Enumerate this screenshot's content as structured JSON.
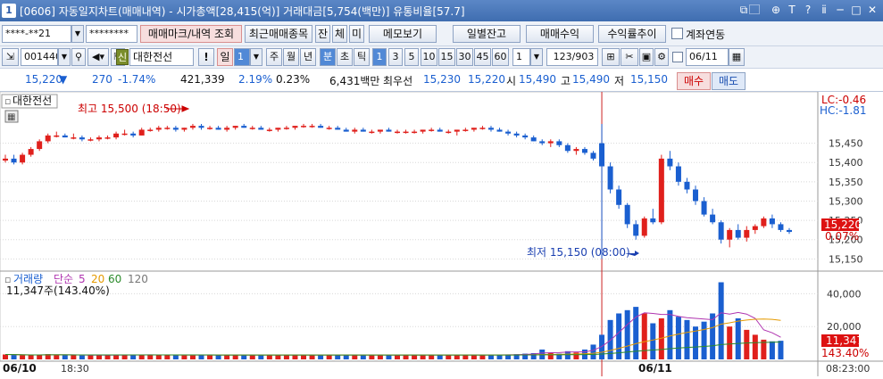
{
  "titlebar": {
    "number": "1",
    "text": "[0606] 자동일지차트(매매내역) - 시가총액[28,415(억)] 거래대금[5,754(백만)] 유통비율[57.7]",
    "buttons": [
      "⧉",
      "⃞",
      "⊕",
      "T",
      "?",
      "ⅱ",
      "─",
      "□",
      "✕"
    ]
  },
  "toolbar1": {
    "account": "****-**21",
    "password": "********",
    "trade_mark": "매매마크/내역 조회",
    "recent": "최근매매종목",
    "jan": "잔",
    "che": "체",
    "mi": "미",
    "memo": "메모보기",
    "daily_balance": "일별잔고",
    "trade_profit": "매매수익",
    "profit_trend": "수익률추이",
    "account_link": "계좌연동"
  },
  "toolbar2": {
    "code": "001440",
    "stock_tag": "신",
    "stock_name": "대한전선",
    "alert": "!",
    "day": "일",
    "day_value": "1",
    "periods": [
      "주",
      "월",
      "년"
    ],
    "min_label": "분",
    "tick1": "초",
    "tick2": "틱",
    "intervals": [
      "1",
      "3",
      "5",
      "10",
      "15",
      "30",
      "45",
      "60"
    ],
    "interval_input": "1",
    "count": "123",
    "count_total": "/903",
    "date": "06/11"
  },
  "quote": {
    "price": "15,220",
    "arrow": "▼",
    "change": "270",
    "change_pct": "-1.74%",
    "volume": "421,339",
    "vol_pct": "2.19%",
    "turnover_pct": "0.23%",
    "amount": "6,431백만",
    "best_label": "최우선",
    "best_ask": "15,230",
    "best_bid": "15,220",
    "open_label": "시",
    "open": "15,490",
    "high_label": "고",
    "high": "15,490",
    "low_label": "저",
    "low": "15,150",
    "buy": "매수",
    "sell": "매도"
  },
  "chart_labels": {
    "stock_label": "대한전선",
    "lc": "LC:-0.46",
    "hc": "HC:-1.81",
    "high_note": "최고 15,500 (18:50)",
    "low_note": "최저 15,150 (08:00)",
    "vol_title": "거래량",
    "ma_label": "단순",
    "ma5": "5",
    "ma20": "20",
    "ma60": "60",
    "ma120": "120",
    "vol_value": "11,347주(143.40%)",
    "x_left": "06/10",
    "x_mid": "18:30",
    "x_day2": "06/11",
    "time_right": "08:23:00",
    "price_now": "15,220",
    "price_pct": "0.07%",
    "vol_now": "11,347",
    "vol_pct": "143.40%"
  },
  "chart_data": {
    "type": "candlestick",
    "price_axis_ticks": [
      15150,
      15200,
      15250,
      15300,
      15350,
      15400,
      15450
    ],
    "volume_axis_ticks": [
      20000,
      40000
    ],
    "day2_x_index": 70,
    "prices": [
      [
        15405,
        15420,
        15400,
        15410
      ],
      [
        15410,
        15420,
        15395,
        15400
      ],
      [
        15400,
        15425,
        15395,
        15420
      ],
      [
        15420,
        15440,
        15415,
        15435
      ],
      [
        15435,
        15460,
        15430,
        15455
      ],
      [
        15455,
        15475,
        15450,
        15470
      ],
      [
        15470,
        15480,
        15465,
        15470
      ],
      [
        15470,
        15475,
        15465,
        15465
      ],
      [
        15465,
        15475,
        15460,
        15465
      ],
      [
        15465,
        15470,
        15455,
        15460
      ],
      [
        15460,
        15465,
        15455,
        15460
      ],
      [
        15460,
        15470,
        15455,
        15465
      ],
      [
        15465,
        15470,
        15460,
        15465
      ],
      [
        15465,
        15480,
        15460,
        15475
      ],
      [
        15475,
        15485,
        15470,
        15475
      ],
      [
        15475,
        15480,
        15465,
        15470
      ],
      [
        15470,
        15490,
        15470,
        15485
      ],
      [
        15485,
        15490,
        15480,
        15485
      ],
      [
        15485,
        15495,
        15480,
        15490
      ],
      [
        15490,
        15495,
        15485,
        15490
      ],
      [
        15490,
        15495,
        15480,
        15485
      ],
      [
        15485,
        15490,
        15480,
        15490
      ],
      [
        15490,
        15500,
        15485,
        15495
      ],
      [
        15495,
        15500,
        15485,
        15490
      ],
      [
        15490,
        15495,
        15485,
        15490
      ],
      [
        15490,
        15495,
        15485,
        15485
      ],
      [
        15485,
        15495,
        15480,
        15490
      ],
      [
        15490,
        15495,
        15485,
        15495
      ],
      [
        15495,
        15500,
        15490,
        15490
      ],
      [
        15490,
        15495,
        15485,
        15490
      ],
      [
        15490,
        15495,
        15485,
        15485
      ],
      [
        15485,
        15490,
        15480,
        15485
      ],
      [
        15485,
        15490,
        15480,
        15490
      ],
      [
        15490,
        15495,
        15485,
        15490
      ],
      [
        15490,
        15495,
        15485,
        15495
      ],
      [
        15495,
        15500,
        15490,
        15495
      ],
      [
        15495,
        15500,
        15490,
        15495
      ],
      [
        15495,
        15500,
        15490,
        15490
      ],
      [
        15490,
        15495,
        15485,
        15490
      ],
      [
        15490,
        15495,
        15485,
        15485
      ],
      [
        15485,
        15490,
        15480,
        15480
      ],
      [
        15480,
        15490,
        15475,
        15485
      ],
      [
        15485,
        15490,
        15480,
        15480
      ],
      [
        15480,
        15485,
        15475,
        15480
      ],
      [
        15480,
        15485,
        15475,
        15485
      ],
      [
        15485,
        15490,
        15480,
        15480
      ],
      [
        15480,
        15485,
        15475,
        15480
      ],
      [
        15480,
        15485,
        15475,
        15480
      ],
      [
        15480,
        15485,
        15475,
        15480
      ],
      [
        15480,
        15485,
        15475,
        15485
      ],
      [
        15485,
        15490,
        15480,
        15485
      ],
      [
        15485,
        15490,
        15480,
        15480
      ],
      [
        15480,
        15485,
        15475,
        15480
      ],
      [
        15480,
        15485,
        15470,
        15485
      ],
      [
        15485,
        15490,
        15480,
        15485
      ],
      [
        15485,
        15490,
        15480,
        15490
      ],
      [
        15490,
        15495,
        15485,
        15490
      ],
      [
        15490,
        15495,
        15480,
        15485
      ],
      [
        15485,
        15490,
        15480,
        15480
      ],
      [
        15480,
        15485,
        15470,
        15475
      ],
      [
        15475,
        15480,
        15465,
        15470
      ],
      [
        15470,
        15475,
        15460,
        15465
      ],
      [
        15465,
        15470,
        15455,
        15455
      ],
      [
        15455,
        15460,
        15445,
        15450
      ],
      [
        15450,
        15460,
        15440,
        15455
      ],
      [
        15455,
        15460,
        15440,
        15445
      ],
      [
        15445,
        15450,
        15425,
        15430
      ],
      [
        15430,
        15440,
        15420,
        15435
      ],
      [
        15435,
        15440,
        15420,
        15425
      ],
      [
        15425,
        15430,
        15405,
        15410
      ],
      [
        15450,
        15500,
        15150,
        15390
      ],
      [
        15390,
        15400,
        15320,
        15330
      ],
      [
        15330,
        15340,
        15280,
        15290
      ],
      [
        15290,
        15295,
        15230,
        15240
      ],
      [
        15240,
        15250,
        15200,
        15210
      ],
      [
        15210,
        15260,
        15205,
        15255
      ],
      [
        15255,
        15280,
        15240,
        15245
      ],
      [
        15245,
        15420,
        15240,
        15410
      ],
      [
        15410,
        15430,
        15380,
        15390
      ],
      [
        15390,
        15400,
        15340,
        15350
      ],
      [
        15350,
        15360,
        15320,
        15330
      ],
      [
        15330,
        15340,
        15290,
        15300
      ],
      [
        15300,
        15310,
        15260,
        15265
      ],
      [
        15265,
        15280,
        15240,
        15245
      ],
      [
        15245,
        15250,
        15190,
        15200
      ],
      [
        15200,
        15230,
        15180,
        15225
      ],
      [
        15225,
        15240,
        15200,
        15205
      ],
      [
        15205,
        15235,
        15195,
        15225
      ],
      [
        15225,
        15240,
        15215,
        15235
      ],
      [
        15235,
        15260,
        15230,
        15255
      ],
      [
        15255,
        15265,
        15230,
        15240
      ],
      [
        15240,
        15245,
        15220,
        15225
      ],
      [
        15225,
        15230,
        15215,
        15220
      ]
    ],
    "volumes": [
      3000,
      2800,
      2500,
      2600,
      2800,
      3200,
      2700,
      2500,
      2600,
      2400,
      2600,
      2700,
      2500,
      2800,
      2600,
      2700,
      2900,
      2800,
      2600,
      2500,
      2700,
      2600,
      2800,
      2700,
      2600,
      2500,
      2600,
      2700,
      2800,
      2600,
      2700,
      2500,
      2600,
      2700,
      2800,
      2600,
      2700,
      2600,
      2500,
      2700,
      2600,
      2800,
      2500,
      2600,
      2700,
      2600,
      2500,
      2700,
      2600,
      2800,
      2700,
      2600,
      2500,
      2600,
      2700,
      2800,
      2600,
      2700,
      2800,
      3000,
      3200,
      3500,
      3800,
      6000,
      4000,
      3500,
      5000,
      4200,
      6000,
      9000,
      15000,
      24000,
      28000,
      30000,
      32000,
      28000,
      22000,
      25000,
      30000,
      26000,
      24000,
      20000,
      23000,
      28000,
      47000,
      20000,
      25000,
      18000,
      15000,
      12000,
      11000,
      11347
    ]
  }
}
